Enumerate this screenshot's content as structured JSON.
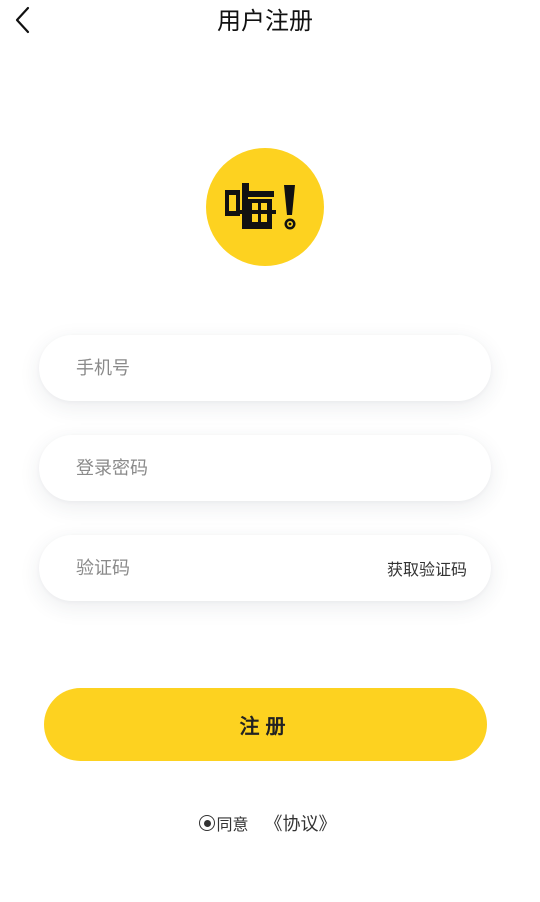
{
  "header": {
    "title": "用户注册",
    "back_icon": "chevron-left-icon"
  },
  "logo": {
    "text": "嗨!",
    "background": "#fdd220"
  },
  "form": {
    "phone": {
      "placeholder": "手机号",
      "value": ""
    },
    "password": {
      "placeholder": "登录密码",
      "value": ""
    },
    "code": {
      "placeholder": "验证码",
      "value": "",
      "get_code_label": "获取验证码"
    }
  },
  "register_button": {
    "label": "注册",
    "color": "#fdd220"
  },
  "agreement": {
    "agree_label": "同意",
    "protocol_label": "《协议》",
    "checked": true
  }
}
